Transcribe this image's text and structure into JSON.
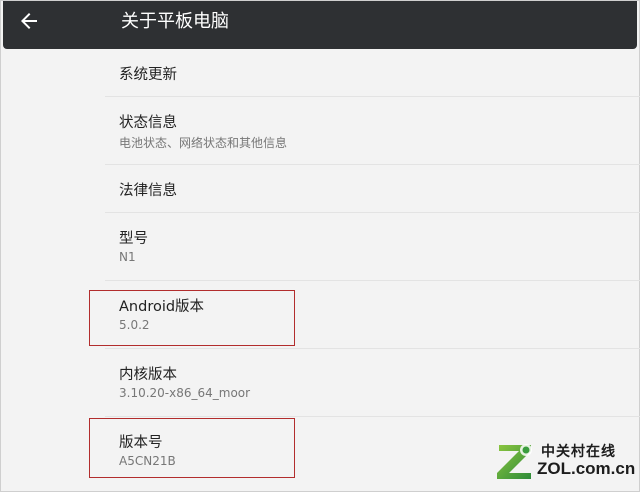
{
  "appbar": {
    "title": "关于平板电脑",
    "back_icon": "arrow-back-icon"
  },
  "items": [
    {
      "title": "系统更新",
      "summary": ""
    },
    {
      "title": "状态信息",
      "summary": "电池状态、网络状态和其他信息"
    },
    {
      "title": "法律信息",
      "summary": ""
    },
    {
      "title": "型号",
      "summary": "N1"
    },
    {
      "title": "Android版本",
      "summary": "5.0.2"
    },
    {
      "title": "内核版本",
      "summary": "3.10.20-x86_64_moor"
    },
    {
      "title": "版本号",
      "summary": "A5CN21B"
    }
  ],
  "annotations": {
    "highlight_color": "#b22d2d"
  },
  "watermark": {
    "cn": "中关村在线",
    "en": "ZOL.com.cn"
  },
  "colors": {
    "appbar_bg": "#2e3033",
    "page_bg": "#f3f3f3",
    "title_text": "#222222",
    "summary_text": "#777777"
  }
}
